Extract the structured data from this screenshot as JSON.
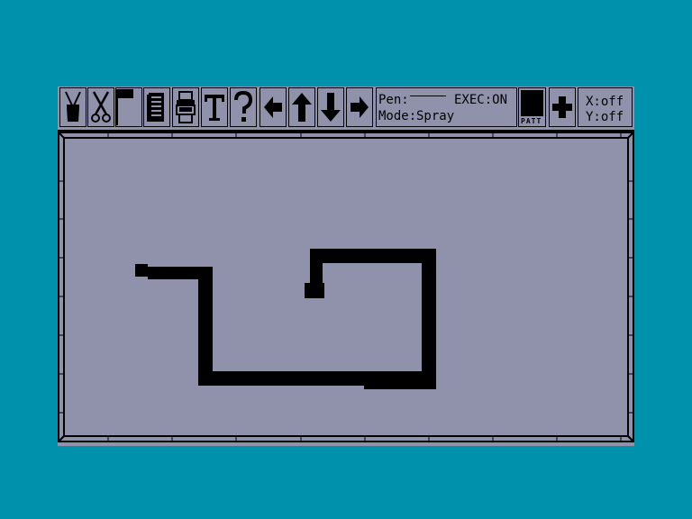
{
  "toolbar": {
    "tools": [
      {
        "name": "paint-tool",
        "icon": "paint-bucket-icon"
      },
      {
        "name": "cut-tool",
        "icon": "scissors-icon"
      },
      {
        "name": "flag-tool",
        "icon": "flag-icon"
      },
      {
        "name": "document-tool",
        "icon": "document-icon"
      },
      {
        "name": "printer-tool",
        "icon": "printer-icon"
      },
      {
        "name": "text-tool",
        "icon": "text-icon"
      },
      {
        "name": "help-tool",
        "icon": "question-mark-icon"
      },
      {
        "name": "scroll-left",
        "icon": "arrow-left-icon"
      },
      {
        "name": "scroll-up",
        "icon": "arrow-up-icon"
      },
      {
        "name": "scroll-down",
        "icon": "arrow-down-icon"
      },
      {
        "name": "scroll-right",
        "icon": "arrow-right-icon"
      }
    ],
    "status": {
      "pen_label": "Pen:",
      "exec_label": "EXEC:ON",
      "mode_label": "Mode:",
      "mode_value": "Spray"
    },
    "pattern": {
      "label": "PATT",
      "color": "#000000"
    },
    "add_icon": "plus-icon",
    "coords": {
      "x_label": "X:off",
      "y_label": "Y:off"
    }
  },
  "colors": {
    "background": "#0092ac",
    "surface": "#9092ac",
    "ink": "#000000"
  }
}
